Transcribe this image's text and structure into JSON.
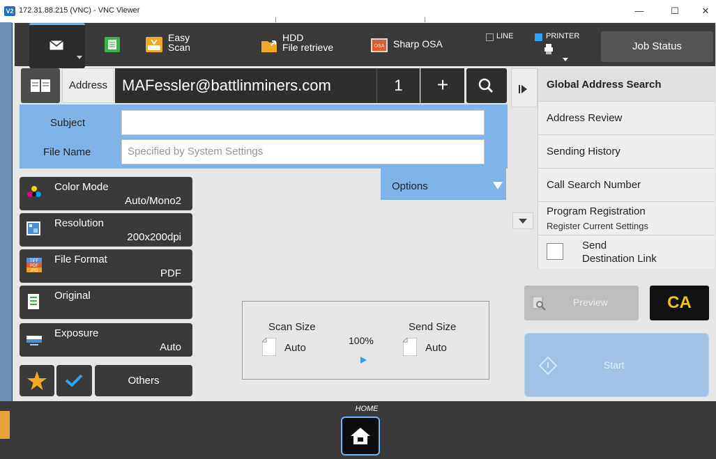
{
  "window": {
    "title": "172.31.88.215 (VNC) - VNC Viewer",
    "logo_text": "V2",
    "minimize": "—",
    "maximize": "☐",
    "close": "✕"
  },
  "topbar": {
    "easy_scan_line1": "Easy",
    "easy_scan_line2": "Scan",
    "hdd_line1": "HDD",
    "hdd_line2": "File retrieve",
    "sharp_osa": "Sharp OSA",
    "line_label": "LINE",
    "printer_label": "PRINTER",
    "job_status": "Job Status"
  },
  "address": {
    "label": "Address",
    "value": "MAFessler@battlinminers.com",
    "count": "1",
    "plus": "+"
  },
  "fields": {
    "subject_label": "Subject",
    "subject_value": "",
    "filename_label": "File Name",
    "filename_placeholder": "Specified by System Settings"
  },
  "right_panel": {
    "items": [
      {
        "label": "Global Address Search"
      },
      {
        "label": "Address Review"
      },
      {
        "label": "Sending History"
      },
      {
        "label": "Call Search Number"
      }
    ],
    "program_registration": "Program Registration",
    "register_current": "Register Current Settings",
    "send_line1": "Send",
    "send_line2": "Destination Link"
  },
  "functions": {
    "color_mode": {
      "name": "Color Mode",
      "value": "Auto/Mono2"
    },
    "resolution": {
      "name": "Resolution",
      "value": "200x200dpi"
    },
    "file_format": {
      "name": "File Format",
      "value": "PDF"
    },
    "original": {
      "name": "Original",
      "value": ""
    },
    "exposure": {
      "name": "Exposure",
      "value": "Auto"
    },
    "others": "Others",
    "file_format_icon_text": [
      "TIFF",
      "PDF",
      "JPG"
    ]
  },
  "options": {
    "label": "Options"
  },
  "sizes": {
    "scan_size_label": "Scan Size",
    "scan_size_value": "Auto",
    "ratio": "100%",
    "send_size_label": "Send Size",
    "send_size_value": "Auto"
  },
  "actions": {
    "preview": "Preview",
    "ca": "CA",
    "start": "Start"
  },
  "bottom": {
    "home_label": "HOME"
  },
  "colors": {
    "accent_blue": "#7fb4e8",
    "ca_yellow": "#f5c400",
    "home_border": "#6bb6ff",
    "start_blue": "#9fc2e6"
  }
}
